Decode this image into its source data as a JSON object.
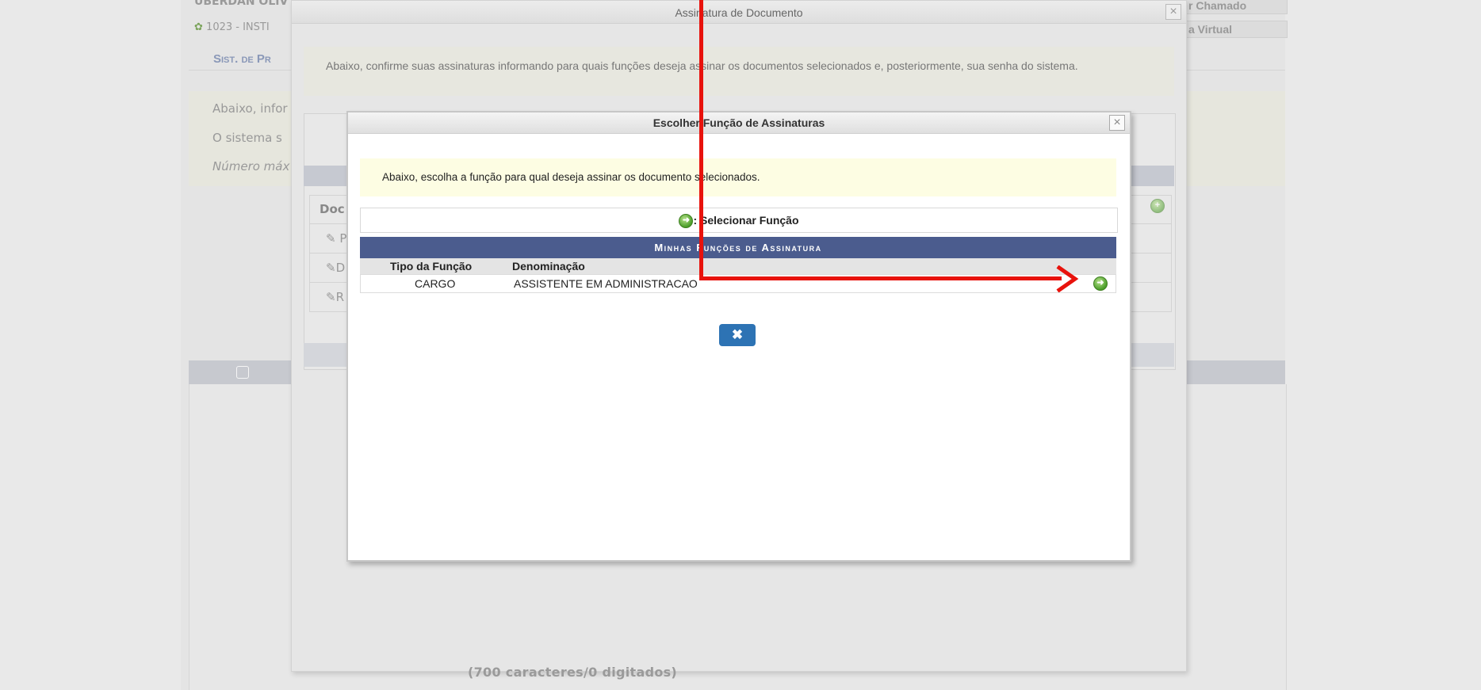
{
  "background": {
    "user_name": "UBERDAN OLIV",
    "unit": "1023 - INSTI",
    "system_title": "Sist. de Pr",
    "warn_lines": [
      "Abaixo, infor",
      "O sistema s",
      "Número máx"
    ],
    "doc_header": "Doc",
    "doc_rows": [
      "P",
      "D",
      "R"
    ],
    "btn_chamado": "r Chamado",
    "btn_virtual": "a Virtual",
    "chars_counter": "(700 caracteres/0 digitados)"
  },
  "outer_dialog": {
    "title": "Assinatura de Documento",
    "close": "×",
    "message": "Abaixo, confirme suas assinaturas informando para quais funções deseja assinar os documentos selecionados e, posteriormente, sua senha do sistema."
  },
  "inner_dialog": {
    "title": "Escolher Função de Assinaturas",
    "close": "×",
    "message": "Abaixo, escolha a função para qual deseja assinar os documento selecionados.",
    "legend": ": Selecionar Função",
    "table_caption": "Minhas Funções de Assinatura",
    "columns": [
      "Tipo da Função",
      "Denominação"
    ],
    "rows": [
      {
        "tipo": "CARGO",
        "denominacao": "ASSISTENTE EM ADMINISTRACAO"
      }
    ],
    "close_button": "✖"
  },
  "icons": {
    "select_function": "green-arrow-circle-icon",
    "add": "green-plus-circle-icon",
    "attachment": "paperclip-icon"
  },
  "colors": {
    "table_caption_bg": "#4b5c8e",
    "close_button_bg": "#2d73b4",
    "annotation_arrow": "#e8120c",
    "message_bg": "#fdfde3"
  }
}
